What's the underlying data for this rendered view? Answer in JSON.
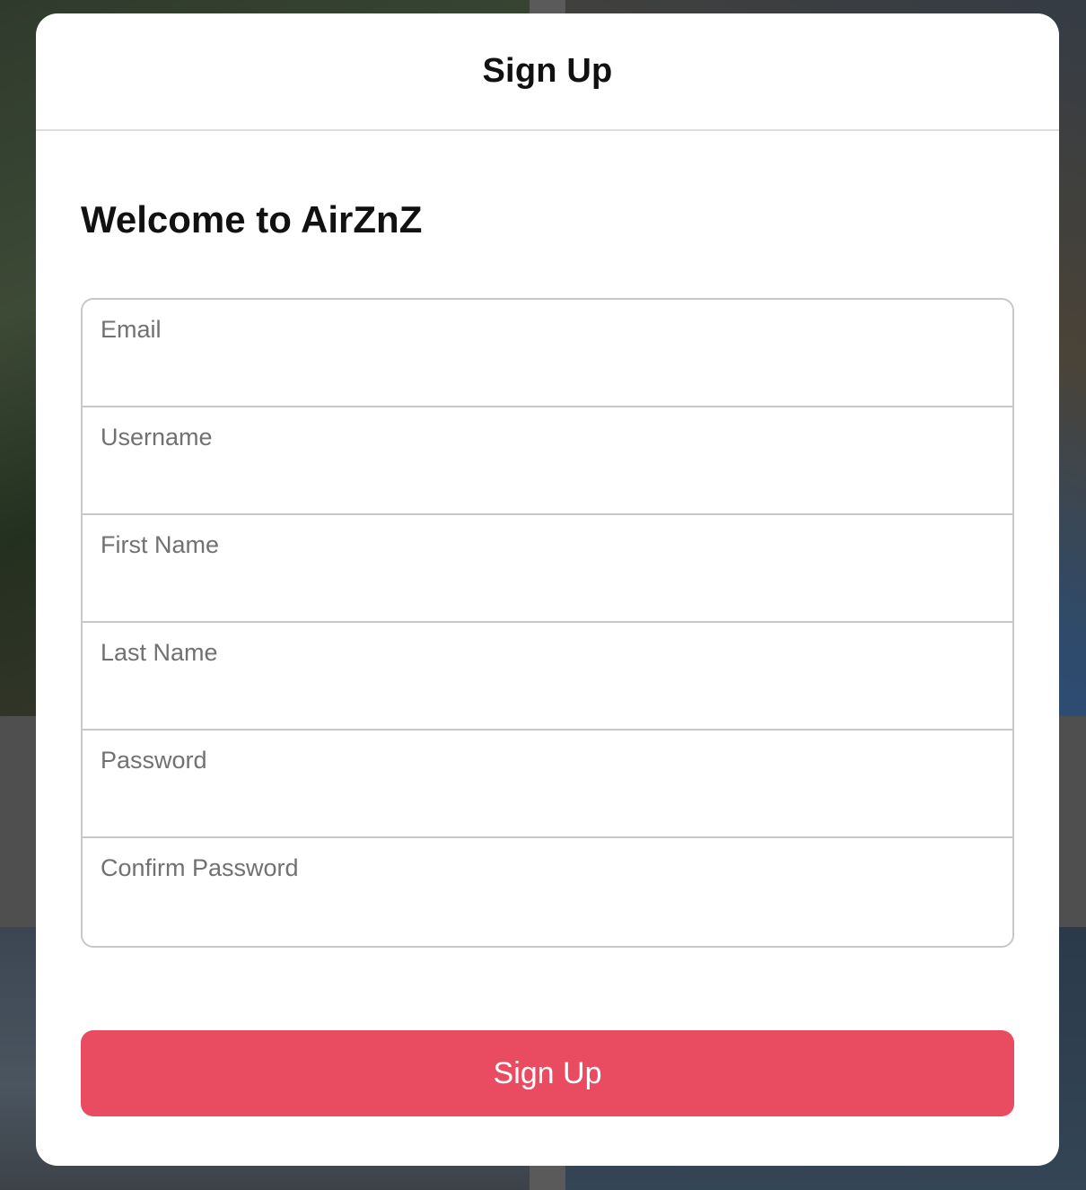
{
  "modal": {
    "title": "Sign Up",
    "welcome": "Welcome to AirZnZ"
  },
  "form": {
    "fields": [
      {
        "label": "Email",
        "value": ""
      },
      {
        "label": "Username",
        "value": ""
      },
      {
        "label": "First Name",
        "value": ""
      },
      {
        "label": "Last Name",
        "value": ""
      },
      {
        "label": "Password",
        "value": ""
      },
      {
        "label": "Confirm Password",
        "value": ""
      }
    ],
    "submit_label": "Sign Up"
  },
  "colors": {
    "accent": "#e94c61",
    "overlay": "#3a3d42"
  }
}
